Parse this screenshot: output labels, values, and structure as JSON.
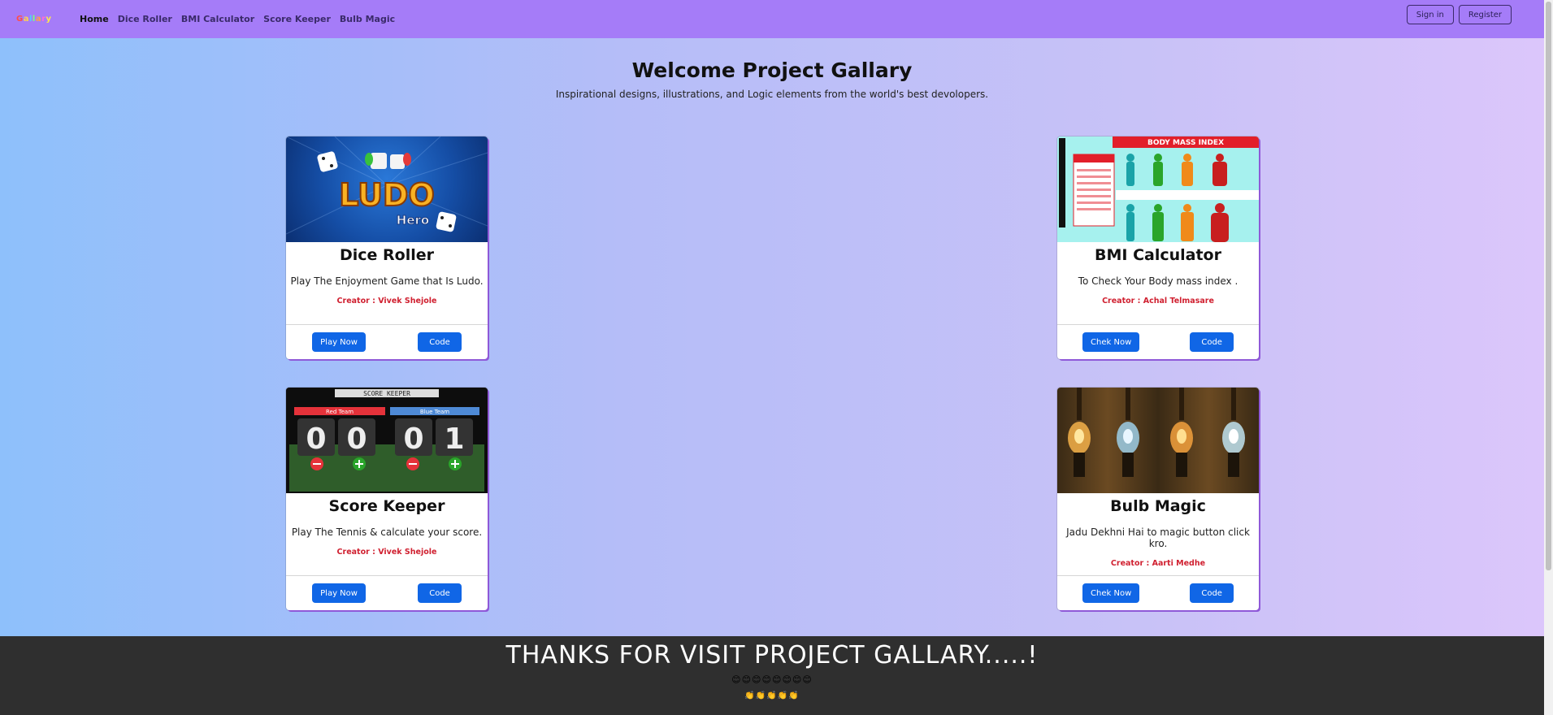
{
  "nav": {
    "logo": "Gallary",
    "links": [
      "Home",
      "Dice Roller",
      "BMI Calculator",
      "Score Keeper",
      "Bulb Magic"
    ],
    "sign_in": "Sign in",
    "register": "Register"
  },
  "hero": {
    "title": "Welcome Project Gallary",
    "subtitle": "Inspirational designs, illustrations, and Logic elements from the world's best devolopers."
  },
  "cards": [
    {
      "title": "Dice Roller",
      "desc": "Play The Enjoyment Game that Is Ludo.",
      "creator": "Creator : Vivek Shejole",
      "primary": "Play Now",
      "code": "Code"
    },
    {
      "title": "BMI Calculator",
      "desc": "To Check Your Body mass index .",
      "creator": "Creator : Achal Telmasare",
      "primary": "Chek Now",
      "code": "Code"
    },
    {
      "title": "Score Keeper",
      "desc": "Play The Tennis & calculate your score.",
      "creator": "Creator : Vivek Shejole",
      "primary": "Play Now",
      "code": "Code"
    },
    {
      "title": "Bulb Magic",
      "desc": "Jadu Dekhni Hai to magic button click kro.",
      "creator": "Creator : Aarti Medhe",
      "primary": "Chek Now",
      "code": "Code"
    }
  ],
  "images": {
    "ludo_logo": "LUDO",
    "ludo_sub": "Hero",
    "bmi_banner": "BODY MASS INDEX",
    "score_header": "SCORE KEEPER",
    "score_red": "Red Team",
    "score_blue": "Blue Team",
    "score_digits": [
      "0",
      "0",
      "0",
      "1"
    ]
  },
  "footer": {
    "title": "THANKS FOR VISIT PROJECT GALLARY.....!",
    "emoji_row1": "😊😊😊😊😊😊😊😊",
    "emoji_row2": "👏👏👏👏👏"
  }
}
